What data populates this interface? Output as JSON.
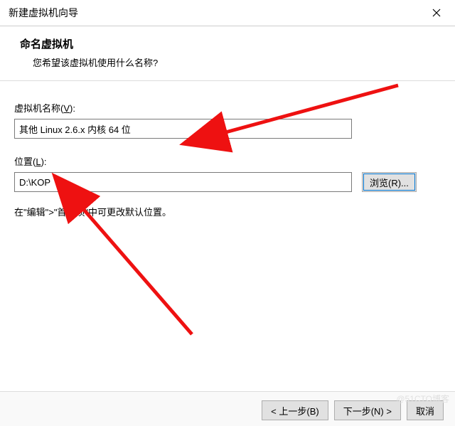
{
  "titlebar": {
    "title": "新建虚拟机向导"
  },
  "header": {
    "title": "命名虚拟机",
    "subtitle": "您希望该虚拟机使用什么名称?"
  },
  "fields": {
    "vm_name": {
      "label_prefix": "虚拟机名称(",
      "label_key": "V",
      "label_suffix": "):",
      "value": "其他 Linux 2.6.x 内核 64 位"
    },
    "location": {
      "label_prefix": "位置(",
      "label_key": "L",
      "label_suffix": "):",
      "value": "D:\\KOP"
    }
  },
  "buttons": {
    "browse": "浏览(R)...",
    "back": "< 上一步(B)",
    "next": "下一步(N) >",
    "cancel": "取消"
  },
  "hint": "在\"编辑\">\"首选项\"中可更改默认位置。",
  "watermark": "@51CTO博客"
}
